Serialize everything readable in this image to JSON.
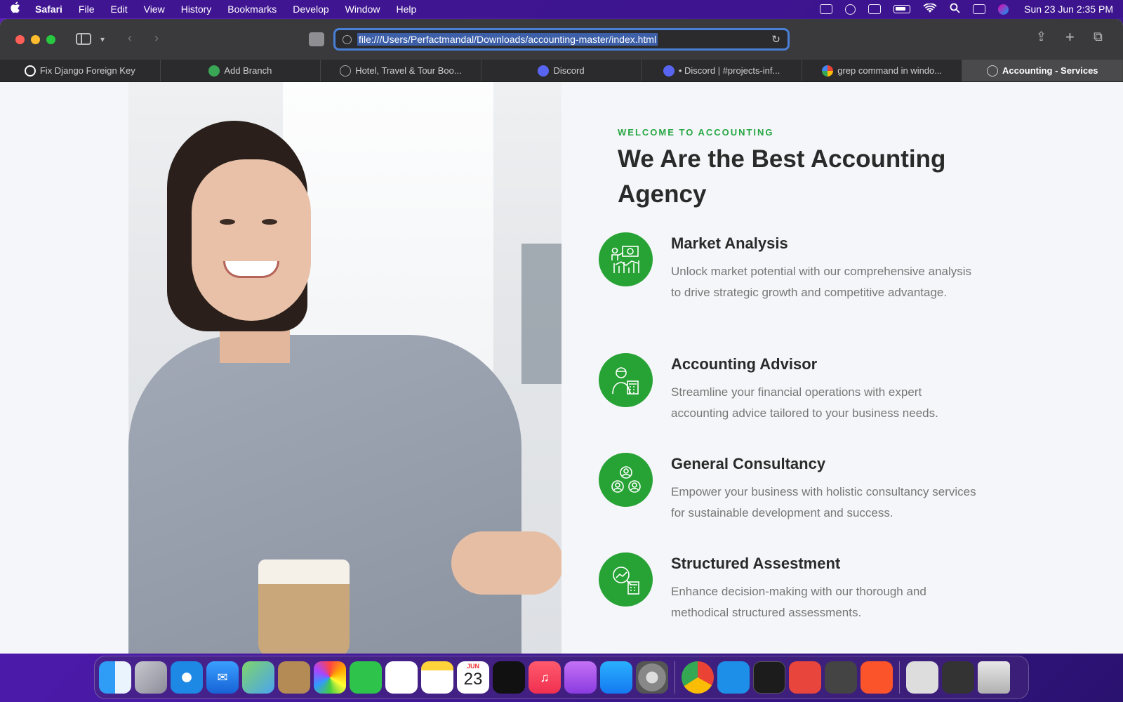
{
  "menubar": {
    "app_name": "Safari",
    "items": [
      "File",
      "Edit",
      "View",
      "History",
      "Bookmarks",
      "Develop",
      "Window",
      "Help"
    ],
    "clock": "Sun 23 Jun  2:35 PM"
  },
  "browser": {
    "url": "file:///Users/Perfactmandal/Downloads/accounting-master/index.html",
    "tabs": [
      {
        "label": "Fix Django Foreign Key",
        "favicon_color": "#ffffff"
      },
      {
        "label": "Add Branch",
        "favicon_color": "#3aa757"
      },
      {
        "label": "Hotel, Travel & Tour Boo...",
        "favicon_color": "#9a9a9a"
      },
      {
        "label": "Discord",
        "favicon_color": "#5865f2"
      },
      {
        "label": "• Discord | #projects-inf...",
        "favicon_color": "#5865f2"
      },
      {
        "label": "grep command in windo...",
        "favicon_color": "#4285f4"
      },
      {
        "label": "Accounting - Services",
        "favicon_color": "#9a9a9a"
      }
    ]
  },
  "page": {
    "eyebrow": "WELCOME TO ACCOUNTING",
    "headline": "We Are the Best Accounting Agency",
    "accent_color": "#27a335",
    "services": [
      {
        "title": "Market Analysis",
        "description": "Unlock market potential with our comprehensive analysis to drive strategic growth and competitive advantage.",
        "icon": "market-chart-icon"
      },
      {
        "title": "Accounting Advisor",
        "description": "Streamline your financial operations with expert accounting advice tailored to your business needs.",
        "icon": "advisor-calculator-icon"
      },
      {
        "title": "General Consultancy",
        "description": "Empower your business with holistic consultancy services for sustainable development and success.",
        "icon": "team-network-icon"
      },
      {
        "title": "Structured Assestment",
        "description": "Enhance decision-making with our thorough and methodical structured assessments.",
        "icon": "magnifier-calculator-icon"
      }
    ]
  },
  "dock": {
    "calendar_month": "JUN",
    "calendar_day": "23"
  }
}
